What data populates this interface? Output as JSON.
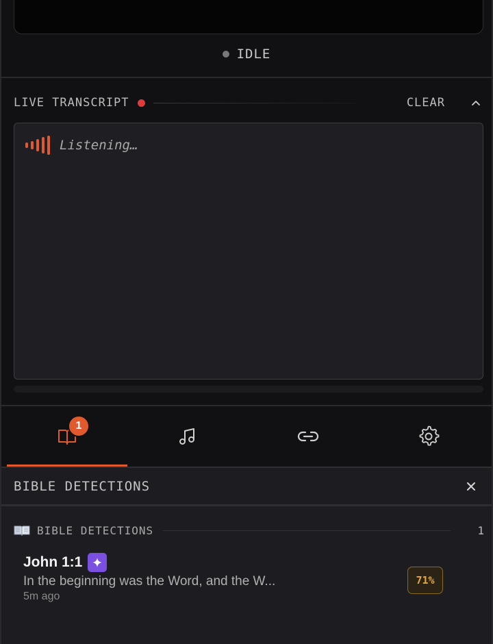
{
  "status": {
    "label": "IDLE"
  },
  "transcript": {
    "title": "LIVE TRANSCRIPT",
    "clear_label": "CLEAR",
    "placeholder": "Listening…"
  },
  "tabs": [
    {
      "icon": "book-icon",
      "badge": "1",
      "active": true
    },
    {
      "icon": "music-note-icon",
      "active": false
    },
    {
      "icon": "link-icon",
      "active": false
    },
    {
      "icon": "gear-icon",
      "active": false
    }
  ],
  "detections_panel": {
    "title": "BIBLE DETECTIONS",
    "section_label": "BIBLE DETECTIONS",
    "count": "1",
    "items": [
      {
        "reference": "John 1:1",
        "text": "In the beginning was the Word, and the W...",
        "time": "5m ago",
        "confidence": "71%"
      }
    ]
  },
  "colors": {
    "accent": "#e05a2e",
    "live_dot": "#e03a3a",
    "ai_chip": "#7b4fe0",
    "confidence": "#e2a73a"
  }
}
